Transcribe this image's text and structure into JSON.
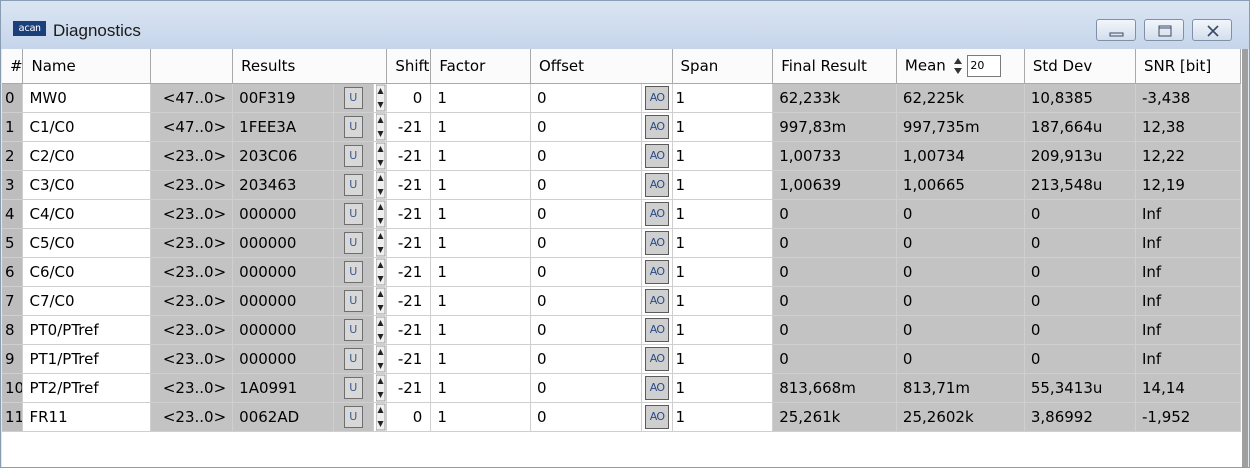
{
  "window": {
    "title": "Diagnostics",
    "app_icon_text": "acan",
    "buttons": [
      "minimize",
      "restore",
      "close"
    ]
  },
  "columns": {
    "index": "#",
    "name": "Name",
    "range": "",
    "results": "Results",
    "shift": "Shift",
    "factor": "Factor",
    "offset": "Offset",
    "span": "Span",
    "final_result": "Final Result",
    "mean": "Mean",
    "mean_count": "20",
    "std_dev": "Std Dev",
    "snr": "SNR [bit]"
  },
  "button_labels": {
    "u": "U",
    "ao": "AO"
  },
  "rows": [
    {
      "idx": "0",
      "name": "MW0",
      "range": "<47..0>",
      "result": "00F319",
      "shift": "0",
      "factor": "1",
      "offset": "0",
      "span": "1",
      "final": "62,233k",
      "mean": "62,225k",
      "std": "10,8385",
      "snr": "-3,438"
    },
    {
      "idx": "1",
      "name": "C1/C0",
      "range": "<47..0>",
      "result": "1FEE3A",
      "shift": "-21",
      "factor": "1",
      "offset": "0",
      "span": "1",
      "final": "997,83m",
      "mean": "997,735m",
      "std": "187,664u",
      "snr": "12,38"
    },
    {
      "idx": "2",
      "name": "C2/C0",
      "range": "<23..0>",
      "result": "203C06",
      "shift": "-21",
      "factor": "1",
      "offset": "0",
      "span": "1",
      "final": "1,00733",
      "mean": "1,00734",
      "std": "209,913u",
      "snr": "12,22"
    },
    {
      "idx": "3",
      "name": "C3/C0",
      "range": "<23..0>",
      "result": "203463",
      "shift": "-21",
      "factor": "1",
      "offset": "0",
      "span": "1",
      "final": "1,00639",
      "mean": "1,00665",
      "std": "213,548u",
      "snr": "12,19"
    },
    {
      "idx": "4",
      "name": "C4/C0",
      "range": "<23..0>",
      "result": "000000",
      "shift": "-21",
      "factor": "1",
      "offset": "0",
      "span": "1",
      "final": "0",
      "mean": "0",
      "std": "0",
      "snr": "Inf"
    },
    {
      "idx": "5",
      "name": "C5/C0",
      "range": "<23..0>",
      "result": "000000",
      "shift": "-21",
      "factor": "1",
      "offset": "0",
      "span": "1",
      "final": "0",
      "mean": "0",
      "std": "0",
      "snr": "Inf"
    },
    {
      "idx": "6",
      "name": "C6/C0",
      "range": "<23..0>",
      "result": "000000",
      "shift": "-21",
      "factor": "1",
      "offset": "0",
      "span": "1",
      "final": "0",
      "mean": "0",
      "std": "0",
      "snr": "Inf"
    },
    {
      "idx": "7",
      "name": "C7/C0",
      "range": "<23..0>",
      "result": "000000",
      "shift": "-21",
      "factor": "1",
      "offset": "0",
      "span": "1",
      "final": "0",
      "mean": "0",
      "std": "0",
      "snr": "Inf"
    },
    {
      "idx": "8",
      "name": "PT0/PTref",
      "range": "<23..0>",
      "result": "000000",
      "shift": "-21",
      "factor": "1",
      "offset": "0",
      "span": "1",
      "final": "0",
      "mean": "0",
      "std": "0",
      "snr": "Inf"
    },
    {
      "idx": "9",
      "name": "PT1/PTref",
      "range": "<23..0>",
      "result": "000000",
      "shift": "-21",
      "factor": "1",
      "offset": "0",
      "span": "1",
      "final": "0",
      "mean": "0",
      "std": "0",
      "snr": "Inf"
    },
    {
      "idx": "10",
      "name": "PT2/PTref",
      "range": "<23..0>",
      "result": "1A0991",
      "shift": "-21",
      "factor": "1",
      "offset": "0",
      "span": "1",
      "final": "813,668m",
      "mean": "813,71m",
      "std": "55,3413u",
      "snr": "14,14"
    },
    {
      "idx": "11",
      "name": "FR11",
      "range": "<23..0>",
      "result": "0062AD",
      "shift": "0",
      "factor": "1",
      "offset": "0",
      "span": "1",
      "final": "25,261k",
      "mean": "25,2602k",
      "std": "3,86992",
      "snr": "-1,952"
    }
  ]
}
